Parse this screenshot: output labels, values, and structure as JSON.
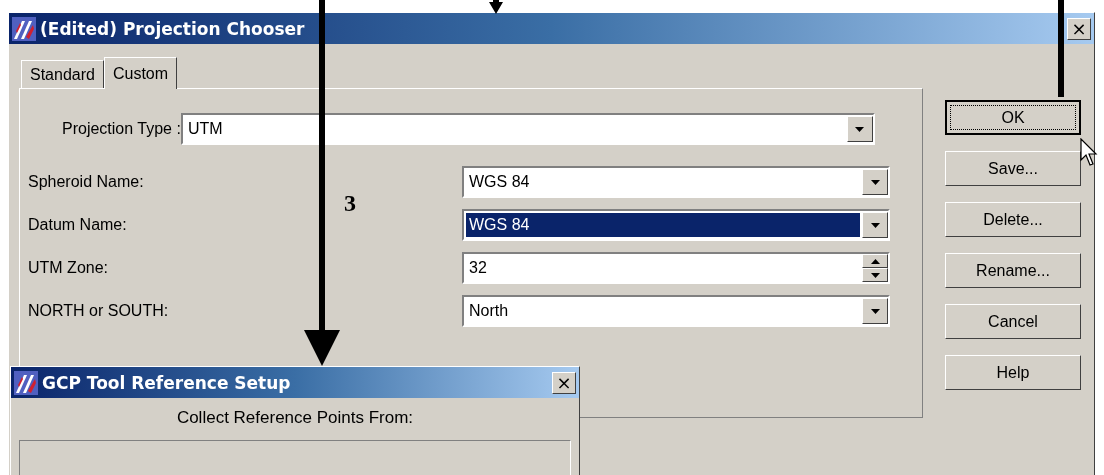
{
  "window": {
    "title": "(Edited) Projection Chooser",
    "close": "×"
  },
  "tabs": [
    {
      "label": "Standard",
      "selected": false
    },
    {
      "label": "Custom",
      "selected": true
    }
  ],
  "projection_type": {
    "label": "Projection Type :",
    "value": "UTM"
  },
  "fields": [
    {
      "kind": "combo",
      "label": "Spheroid Name:",
      "value": "WGS 84",
      "highlighted": false
    },
    {
      "kind": "combo",
      "label": "Datum Name:",
      "value": "WGS 84",
      "highlighted": true
    },
    {
      "kind": "spin",
      "label": "UTM Zone:",
      "value": "32",
      "highlighted": false
    },
    {
      "kind": "combo",
      "label": "NORTH or SOUTH:",
      "value": "North",
      "highlighted": false
    }
  ],
  "buttons": [
    {
      "label": "OK",
      "default": true
    },
    {
      "label": "Save...",
      "default": false
    },
    {
      "label": "Delete...",
      "default": false
    },
    {
      "label": "Rename...",
      "default": false
    },
    {
      "label": "Cancel",
      "default": false
    },
    {
      "label": "Help",
      "default": false
    }
  ],
  "gcp_dialog": {
    "title": "GCP Tool Reference Setup",
    "close": "×",
    "heading": "Collect Reference Points From:"
  },
  "annotations": [
    {
      "label": "3"
    }
  ]
}
